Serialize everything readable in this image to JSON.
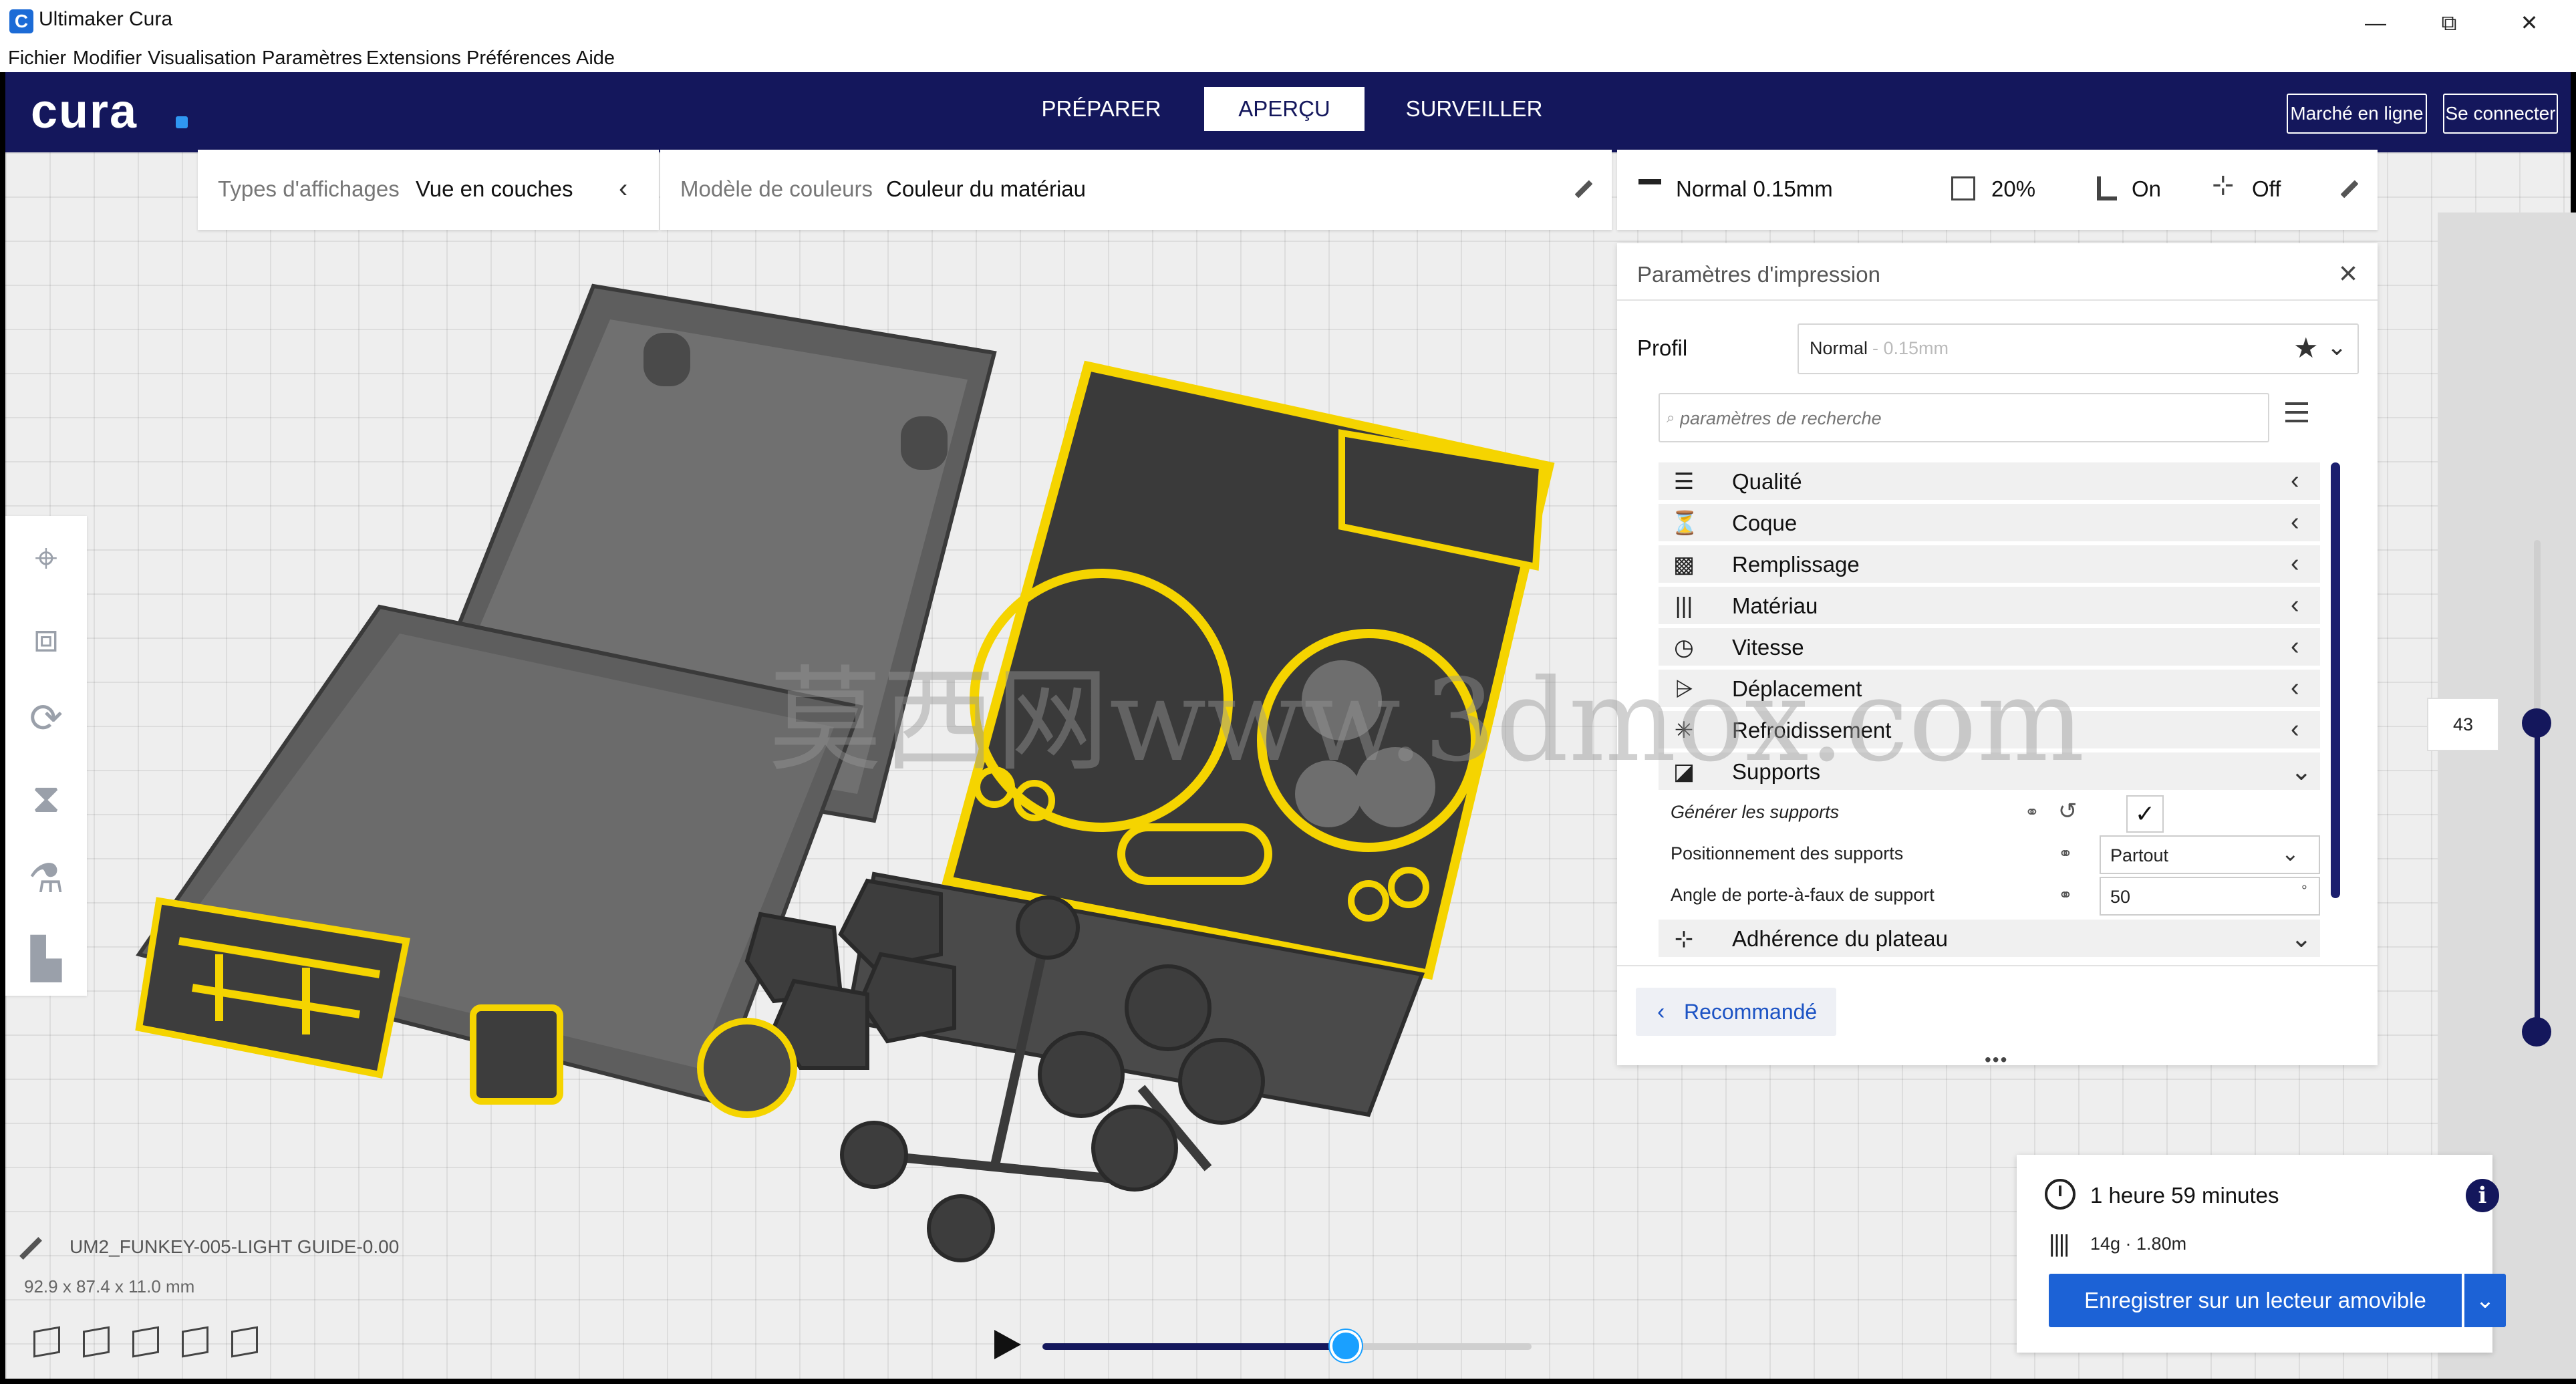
{
  "window": {
    "title": "Ultimaker Cura",
    "controls": {
      "minimize": "—",
      "maximize": "⧉",
      "close": "✕"
    }
  },
  "menu": {
    "items": [
      "Fichier",
      "Modifier",
      "Visualisation",
      "Paramètres",
      "Extensions",
      "Préférences",
      "Aide"
    ]
  },
  "header": {
    "logo": "cura",
    "tabs": [
      "PRÉPARER",
      "APERÇU",
      "SURVEILLER"
    ],
    "active_tab": "APERÇU",
    "marketplace": "Marché en ligne",
    "signin": "Se connecter"
  },
  "view_bar": {
    "view_type_label": "Types d'affichages",
    "view_type_value": "Vue en couches",
    "color_scheme_label": "Modèle de couleurs",
    "color_scheme_value": "Couleur du matériau"
  },
  "settings_bar": {
    "profile": "Normal 0.15mm",
    "infill": "20%",
    "support": "On",
    "adhesion": "Off"
  },
  "print_settings": {
    "title": "Paramètres d'impression",
    "profile_label": "Profil",
    "profile_name": "Normal",
    "profile_layer": "- 0.15mm",
    "search_placeholder": "paramètres de recherche",
    "categories": [
      {
        "label": "Qualité",
        "icon": "quality-icon",
        "glyph": "☰",
        "expanded": false
      },
      {
        "label": "Coque",
        "icon": "shell-icon",
        "glyph": "⏳",
        "expanded": false
      },
      {
        "label": "Remplissage",
        "icon": "infill-icon",
        "glyph": "▩",
        "expanded": false
      },
      {
        "label": "Matériau",
        "icon": "material-icon",
        "glyph": "|||",
        "expanded": false
      },
      {
        "label": "Vitesse",
        "icon": "speed-icon",
        "glyph": "◷",
        "expanded": false
      },
      {
        "label": "Déplacement",
        "icon": "travel-icon",
        "glyph": "⩥",
        "expanded": false
      },
      {
        "label": "Refroidissement",
        "icon": "cooling-icon",
        "glyph": "✳",
        "expanded": false
      },
      {
        "label": "Supports",
        "icon": "support-icon",
        "glyph": "◪",
        "expanded": true
      }
    ],
    "support_settings": {
      "generate_label": "Générer les supports",
      "generate_checked": true,
      "placement_label": "Positionnement des supports",
      "placement_value": "Partout",
      "angle_label": "Angle de porte-à-faux de support",
      "angle_value": "50",
      "angle_unit": "°"
    },
    "adhesion_category": {
      "label": "Adhérence du plateau",
      "icon": "adhesion-icon",
      "glyph": "⊹"
    },
    "recommended_button": "Recommandé"
  },
  "layer_slider": {
    "current": "43"
  },
  "object_info": {
    "name": "UM2_FUNKEY-005-LIGHT GUIDE-0.00",
    "dimensions": "92.9 x 87.4 x 11.0 mm"
  },
  "simulation": {
    "progress": 0.62
  },
  "print_info": {
    "time": "1 heure 59 minutes",
    "material": "14g · 1.80m",
    "save_button": "Enregistrer sur un lecteur amovible"
  },
  "watermark": "莫西网www.3dmox.com",
  "colors": {
    "accent": "#14175c",
    "primary_button": "#1c62d6",
    "layer_yellow": "#f5d400",
    "model_grey": "#555555"
  }
}
